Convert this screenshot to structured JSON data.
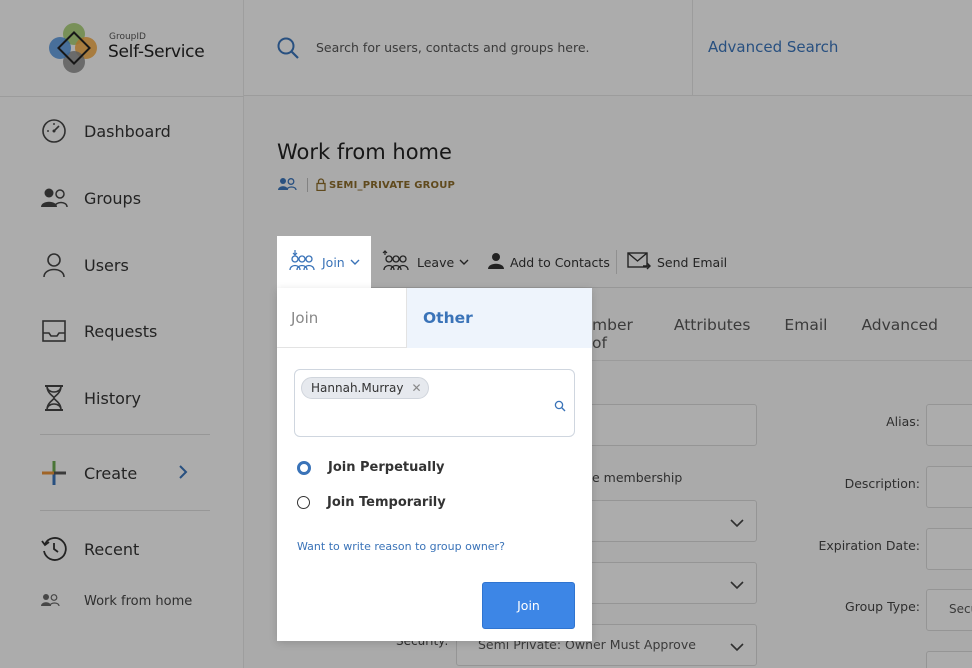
{
  "brand": {
    "small": "GroupID",
    "name": "Self-Service"
  },
  "header": {
    "search_placeholder": "Search for users, contacts and groups here.",
    "advanced_search": "Advanced Search"
  },
  "sidebar": {
    "items": [
      {
        "label": "Dashboard",
        "icon": "dashboard-icon"
      },
      {
        "label": "Groups",
        "icon": "groups-icon"
      },
      {
        "label": "Users",
        "icon": "user-icon"
      },
      {
        "label": "Requests",
        "icon": "inbox-icon"
      },
      {
        "label": "History",
        "icon": "hourglass-icon"
      }
    ],
    "create": "Create",
    "recent": "Recent",
    "recent_items": [
      "Work from home"
    ]
  },
  "group": {
    "title": "Work from home",
    "type_badge": "SEMI_PRIVATE GROUP"
  },
  "toolbar": {
    "join": "Join",
    "leave": "Leave",
    "add_to_contacts": "Add to Contacts",
    "send_email": "Send Email"
  },
  "tabs": [
    "mber of",
    "Attributes",
    "Email",
    "Advanced"
  ],
  "form": {
    "membership_text": "e membership",
    "alias_label": "Alias:",
    "description_label": "Description:",
    "expiration_label": "Expiration Date:",
    "group_type_label": "Group Type:",
    "group_type_value": "Secu",
    "security_label": "Security:",
    "security_value": "Semi Private: Owner Must Approve"
  },
  "popup": {
    "tab_join": "Join",
    "tab_other": "Other",
    "selected_user": "Hannah.Murray",
    "option_perpetual": "Join Perpetually",
    "option_temporary": "Join Temporarily",
    "selected_option": "Join Perpetually",
    "reason_link": "Want to write reason to group owner?",
    "join_button": "Join"
  },
  "colors": {
    "accent": "#3a73b8",
    "button": "#3d86e6",
    "badge": "#8a6a2a"
  }
}
